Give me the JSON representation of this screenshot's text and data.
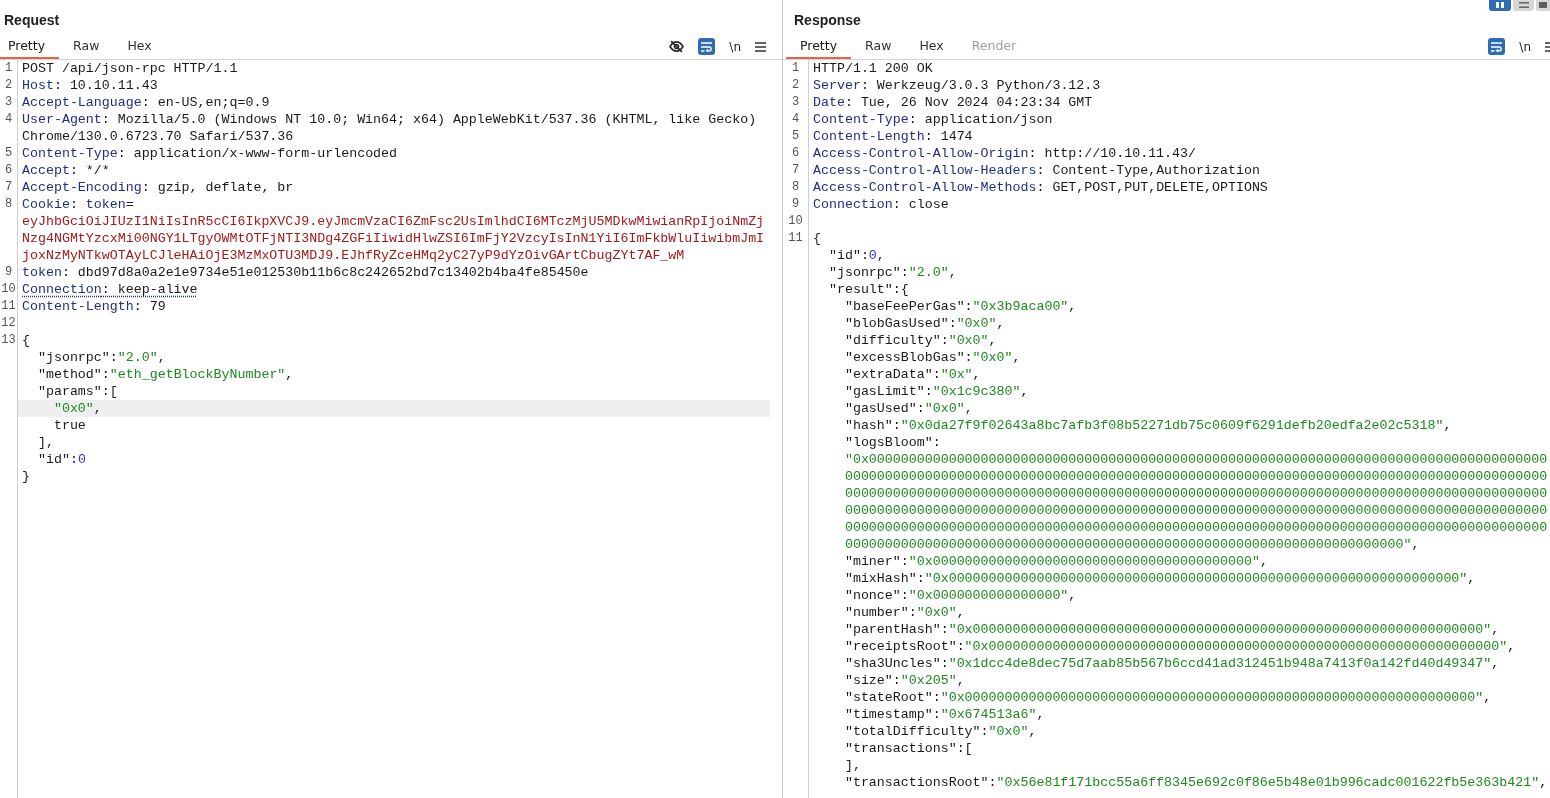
{
  "request": {
    "title": "Request",
    "tabs": [
      {
        "label": "Pretty",
        "selected": true
      },
      {
        "label": "Raw",
        "selected": false
      },
      {
        "label": "Hex",
        "selected": false
      }
    ],
    "toolbar": [
      {
        "kind": "hide",
        "on": false
      },
      {
        "kind": "wrap",
        "on": true
      },
      {
        "kind": "newline",
        "label": "\\n",
        "on": false
      },
      {
        "kind": "menu"
      }
    ],
    "lines": [
      {
        "number": "1",
        "selected": false,
        "flagged": false,
        "segments": [
          {
            "kind": "text",
            "text": "POST /api/json-rpc HTTP/1.1"
          }
        ]
      },
      {
        "number": "2",
        "selected": false,
        "flagged": false,
        "segments": [
          {
            "kind": "name",
            "text": "Host"
          },
          {
            "kind": "text",
            "text": ": 10.10.11.43"
          }
        ]
      },
      {
        "number": "3",
        "selected": false,
        "flagged": false,
        "segments": [
          {
            "kind": "name",
            "text": "Accept-Language"
          },
          {
            "kind": "text",
            "text": ": en-US,en;q=0.9"
          }
        ]
      },
      {
        "number": "4",
        "selected": false,
        "flagged": false,
        "segments": [
          {
            "kind": "name",
            "text": "User-Agent"
          },
          {
            "kind": "text",
            "text": ": Mozilla/5.0 (Windows NT 10.0; Win64; x64) AppleWebKit/537.36 (KHTML, like Gecko) Chrome/130.0.6723.70 Safari/537.36"
          }
        ]
      },
      {
        "number": "5",
        "selected": false,
        "flagged": false,
        "segments": [
          {
            "kind": "name",
            "text": "Content-Type"
          },
          {
            "kind": "text",
            "text": ": application/x-www-form-urlencoded"
          }
        ]
      },
      {
        "number": "6",
        "selected": false,
        "flagged": false,
        "segments": [
          {
            "kind": "name",
            "text": "Accept"
          },
          {
            "kind": "text",
            "text": ": */*"
          }
        ]
      },
      {
        "number": "7",
        "selected": false,
        "flagged": false,
        "segments": [
          {
            "kind": "name",
            "text": "Accept-Encoding"
          },
          {
            "kind": "text",
            "text": ": gzip, deflate, br"
          }
        ]
      },
      {
        "number": "8",
        "selected": false,
        "flagged": false,
        "segments": [
          {
            "kind": "name",
            "text": "Cookie"
          },
          {
            "kind": "text",
            "text": ": "
          },
          {
            "kind": "name",
            "text": "token"
          },
          {
            "kind": "text",
            "text": "="
          },
          {
            "kind": "cookie",
            "text": "eyJhbGciOiJIUzI1NiIsInR5cCI6IkpXVCJ9.eyJmcmVzaCI6ZmFsc2UsImlhdCI6MTczMjU5MDkwMiwianRpIjoiNmZjNzg4NGMtYzcxMi00NGY1LTgyOWMtOTFjNTI3NDg4ZGFiIiwidHlwZSI6ImFjY2VzcyIsInN1YiI6ImFkbWluIiwibmJmIjoxNzMyNTkwOTAyLCJleHAiOjE3MzMxOTU3MDJ9.EJhfRyZceHMq2yC27yP9dYzOivGArtCbugZYt7AF_wM"
          }
        ]
      },
      {
        "number": "9",
        "selected": false,
        "flagged": false,
        "segments": [
          {
            "kind": "name",
            "text": "token"
          },
          {
            "kind": "text",
            "text": ": dbd97d8a0a2e1e9734e51e012530b11b6c8c242652bd7c13402b4ba4fe85450e"
          }
        ]
      },
      {
        "number": "10",
        "selected": false,
        "flagged": true,
        "segments": [
          {
            "kind": "name",
            "text": "Connection"
          },
          {
            "kind": "text",
            "text": ": keep-alive"
          }
        ]
      },
      {
        "number": "11",
        "selected": false,
        "flagged": false,
        "segments": [
          {
            "kind": "name",
            "text": "Content-Length"
          },
          {
            "kind": "text",
            "text": ": 79"
          }
        ]
      },
      {
        "number": "12",
        "selected": false
      },
      {
        "number": "13",
        "selected": false,
        "flagged": false,
        "segments": [
          {
            "kind": "text",
            "text": "{"
          }
        ]
      },
      {
        "selected": false,
        "flagged": false,
        "segments": [
          {
            "kind": "text",
            "text": "  \"jsonrpc\":"
          },
          {
            "kind": "string",
            "text": "\"2.0\""
          },
          {
            "kind": "text",
            "text": ","
          }
        ]
      },
      {
        "selected": false,
        "flagged": false,
        "segments": [
          {
            "kind": "text",
            "text": "  \"method\":"
          },
          {
            "kind": "string",
            "text": "\"eth_getBlockByNumber\""
          },
          {
            "kind": "text",
            "text": ","
          }
        ]
      },
      {
        "selected": false,
        "flagged": false,
        "segments": [
          {
            "kind": "text",
            "text": "  \"params\":["
          }
        ]
      },
      {
        "selected": true,
        "flagged": false,
        "segments": [
          {
            "kind": "string",
            "text": "    \"0x0\""
          },
          {
            "kind": "text",
            "text": ","
          }
        ]
      },
      {
        "selected": false,
        "flagged": false,
        "segments": [
          {
            "kind": "text",
            "text": "    true"
          }
        ]
      },
      {
        "selected": false,
        "flagged": false,
        "segments": [
          {
            "kind": "text",
            "text": "  ],"
          }
        ]
      },
      {
        "selected": false,
        "flagged": false,
        "segments": [
          {
            "kind": "text",
            "text": "  \"id\":"
          },
          {
            "kind": "number",
            "text": "0"
          }
        ]
      },
      {
        "selected": false,
        "flagged": false,
        "segments": [
          {
            "kind": "text",
            "text": "}"
          }
        ]
      }
    ]
  },
  "response": {
    "title": "Response",
    "layout_buttons": [
      {
        "kind": "columns",
        "selected": true
      },
      {
        "kind": "rows",
        "selected": false
      },
      {
        "kind": "tabs",
        "selected": false
      }
    ],
    "tabs": [
      {
        "label": "Pretty",
        "selected": true,
        "disabled": false
      },
      {
        "label": "Raw",
        "selected": false,
        "disabled": false
      },
      {
        "label": "Hex",
        "selected": false,
        "disabled": false
      },
      {
        "label": "Render",
        "selected": false,
        "disabled": true
      }
    ],
    "toolbar": [
      {
        "kind": "wrap",
        "on": true
      },
      {
        "kind": "newline",
        "label": "\\n",
        "on": false
      },
      {
        "kind": "menu"
      }
    ],
    "lines": [
      {
        "number": "1",
        "segments": [
          {
            "kind": "text",
            "text": "HTTP/1.1 200 OK"
          }
        ]
      },
      {
        "number": "2",
        "segments": [
          {
            "kind": "name",
            "text": "Server"
          },
          {
            "kind": "text",
            "text": ": Werkzeug/3.0.3 Python/3.12.3"
          }
        ]
      },
      {
        "number": "3",
        "segments": [
          {
            "kind": "name",
            "text": "Date"
          },
          {
            "kind": "text",
            "text": ": Tue, 26 Nov 2024 04:23:34 GMT"
          }
        ]
      },
      {
        "number": "4",
        "segments": [
          {
            "kind": "name",
            "text": "Content-Type"
          },
          {
            "kind": "text",
            "text": ": application/json"
          }
        ]
      },
      {
        "number": "5",
        "segments": [
          {
            "kind": "name",
            "text": "Content-Length"
          },
          {
            "kind": "text",
            "text": ": 1474"
          }
        ]
      },
      {
        "number": "6",
        "segments": [
          {
            "kind": "name",
            "text": "Access-Control-Allow-Origin"
          },
          {
            "kind": "text",
            "text": ": http://10.10.11.43/"
          }
        ]
      },
      {
        "number": "7",
        "segments": [
          {
            "kind": "name",
            "text": "Access-Control-Allow-Headers"
          },
          {
            "kind": "text",
            "text": ": Content-Type,Authorization"
          }
        ]
      },
      {
        "number": "8",
        "segments": [
          {
            "kind": "name",
            "text": "Access-Control-Allow-Methods"
          },
          {
            "kind": "text",
            "text": ": GET,POST,PUT,DELETE,OPTIONS"
          }
        ]
      },
      {
        "number": "9",
        "segments": [
          {
            "kind": "name",
            "text": "Connection"
          },
          {
            "kind": "text",
            "text": ": close"
          }
        ]
      },
      {
        "number": "10"
      },
      {
        "number": "11",
        "segments": [
          {
            "kind": "text",
            "text": "{"
          }
        ]
      },
      {
        "segments": [
          {
            "kind": "text",
            "text": "  \"id\":"
          },
          {
            "kind": "number",
            "text": "0"
          },
          {
            "kind": "text",
            "text": ","
          }
        ]
      },
      {
        "segments": [
          {
            "kind": "text",
            "text": "  \"jsonrpc\":"
          },
          {
            "kind": "string",
            "text": "\"2.0\""
          },
          {
            "kind": "text",
            "text": ","
          }
        ]
      },
      {
        "segments": [
          {
            "kind": "text",
            "text": "  \"result\":{"
          }
        ]
      },
      {
        "segments": [
          {
            "kind": "text",
            "text": "    \"baseFeePerGas\":"
          },
          {
            "kind": "string",
            "text": "\"0x3b9aca00\""
          },
          {
            "kind": "text",
            "text": ","
          }
        ]
      },
      {
        "segments": [
          {
            "kind": "text",
            "text": "    \"blobGasUsed\":"
          },
          {
            "kind": "string",
            "text": "\"0x0\""
          },
          {
            "kind": "text",
            "text": ","
          }
        ]
      },
      {
        "segments": [
          {
            "kind": "text",
            "text": "    \"difficulty\":"
          },
          {
            "kind": "string",
            "text": "\"0x0\""
          },
          {
            "kind": "text",
            "text": ","
          }
        ]
      },
      {
        "segments": [
          {
            "kind": "text",
            "text": "    \"excessBlobGas\":"
          },
          {
            "kind": "string",
            "text": "\"0x0\""
          },
          {
            "kind": "text",
            "text": ","
          }
        ]
      },
      {
        "segments": [
          {
            "kind": "text",
            "text": "    \"extraData\":"
          },
          {
            "kind": "string",
            "text": "\"0x\""
          },
          {
            "kind": "text",
            "text": ","
          }
        ]
      },
      {
        "segments": [
          {
            "kind": "text",
            "text": "    \"gasLimit\":"
          },
          {
            "kind": "string",
            "text": "\"0x1c9c380\""
          },
          {
            "kind": "text",
            "text": ","
          }
        ]
      },
      {
        "segments": [
          {
            "kind": "text",
            "text": "    \"gasUsed\":"
          },
          {
            "kind": "string",
            "text": "\"0x0\""
          },
          {
            "kind": "text",
            "text": ","
          }
        ]
      },
      {
        "segments": [
          {
            "kind": "text",
            "text": "    \"hash\":"
          },
          {
            "kind": "string",
            "text": "\"0x0da27f9f02643a8bc7afb3f08b52271db75c0609f6291defb20edfa2e02c5318\""
          },
          {
            "kind": "text",
            "text": ","
          }
        ]
      },
      {
        "segments": [
          {
            "kind": "text",
            "text": "    \"logsBloom\":"
          }
        ]
      },
      {
        "segments": [
          {
            "kind": "string",
            "text": "    \"0x0000000000000000000000000000000000000000000000000000000000000000000000000000000000000"
          }
        ]
      },
      {
        "segments": [
          {
            "kind": "string",
            "text": "    0000000000000000000000000000000000000000000000000000000000000000000000000000000000000000"
          }
        ]
      },
      {
        "segments": [
          {
            "kind": "string",
            "text": "    0000000000000000000000000000000000000000000000000000000000000000000000000000000000000000"
          }
        ]
      },
      {
        "segments": [
          {
            "kind": "string",
            "text": "    0000000000000000000000000000000000000000000000000000000000000000000000000000000000000000"
          }
        ]
      },
      {
        "segments": [
          {
            "kind": "string",
            "text": "    0000000000000000000000000000000000000000000000000000000000000000000000000000000000000000"
          }
        ]
      },
      {
        "segments": [
          {
            "kind": "string",
            "text": "    0000000000000000000000000000000000000000000000000000000000000000000000\""
          },
          {
            "kind": "text",
            "text": ","
          }
        ]
      },
      {
        "segments": [
          {
            "kind": "text",
            "text": "    \"miner\":"
          },
          {
            "kind": "string",
            "text": "\"0x0000000000000000000000000000000000000000\""
          },
          {
            "kind": "text",
            "text": ","
          }
        ]
      },
      {
        "segments": [
          {
            "kind": "text",
            "text": "    \"mixHash\":"
          },
          {
            "kind": "string",
            "text": "\"0x0000000000000000000000000000000000000000000000000000000000000000\""
          },
          {
            "kind": "text",
            "text": ","
          }
        ]
      },
      {
        "segments": [
          {
            "kind": "text",
            "text": "    \"nonce\":"
          },
          {
            "kind": "string",
            "text": "\"0x0000000000000000\""
          },
          {
            "kind": "text",
            "text": ","
          }
        ]
      },
      {
        "segments": [
          {
            "kind": "text",
            "text": "    \"number\":"
          },
          {
            "kind": "string",
            "text": "\"0x0\""
          },
          {
            "kind": "text",
            "text": ","
          }
        ]
      },
      {
        "segments": [
          {
            "kind": "text",
            "text": "    \"parentHash\":"
          },
          {
            "kind": "string",
            "text": "\"0x0000000000000000000000000000000000000000000000000000000000000000\""
          },
          {
            "kind": "text",
            "text": ","
          }
        ]
      },
      {
        "segments": [
          {
            "kind": "text",
            "text": "    \"receiptsRoot\":"
          },
          {
            "kind": "string",
            "text": "\"0x0000000000000000000000000000000000000000000000000000000000000000\""
          },
          {
            "kind": "text",
            "text": ","
          }
        ]
      },
      {
        "segments": [
          {
            "kind": "text",
            "text": "    \"sha3Uncles\":"
          },
          {
            "kind": "string",
            "text": "\"0x1dcc4de8dec75d7aab85b567b6ccd41ad312451b948a7413f0a142fd40d49347\""
          },
          {
            "kind": "text",
            "text": ","
          }
        ]
      },
      {
        "segments": [
          {
            "kind": "text",
            "text": "    \"size\":"
          },
          {
            "kind": "string",
            "text": "\"0x205\""
          },
          {
            "kind": "text",
            "text": ","
          }
        ]
      },
      {
        "segments": [
          {
            "kind": "text",
            "text": "    \"stateRoot\":"
          },
          {
            "kind": "string",
            "text": "\"0x0000000000000000000000000000000000000000000000000000000000000000\""
          },
          {
            "kind": "text",
            "text": ","
          }
        ]
      },
      {
        "segments": [
          {
            "kind": "text",
            "text": "    \"timestamp\":"
          },
          {
            "kind": "string",
            "text": "\"0x674513a6\""
          },
          {
            "kind": "text",
            "text": ","
          }
        ]
      },
      {
        "segments": [
          {
            "kind": "text",
            "text": "    \"totalDifficulty\":"
          },
          {
            "kind": "string",
            "text": "\"0x0\""
          },
          {
            "kind": "text",
            "text": ","
          }
        ]
      },
      {
        "segments": [
          {
            "kind": "text",
            "text": "    \"transactions\":["
          }
        ]
      },
      {
        "segments": [
          {
            "kind": "text",
            "text": "    ],"
          }
        ]
      },
      {
        "segments": [
          {
            "kind": "text",
            "text": "    \"transactionsRoot\":"
          },
          {
            "kind": "string",
            "text": "\"0x56e81f171bcc55a6ff8345e692c0f86e5b48e01b996cadc001622fb5e363b421\""
          },
          {
            "kind": "text",
            "text": ","
          }
        ]
      }
    ]
  }
}
